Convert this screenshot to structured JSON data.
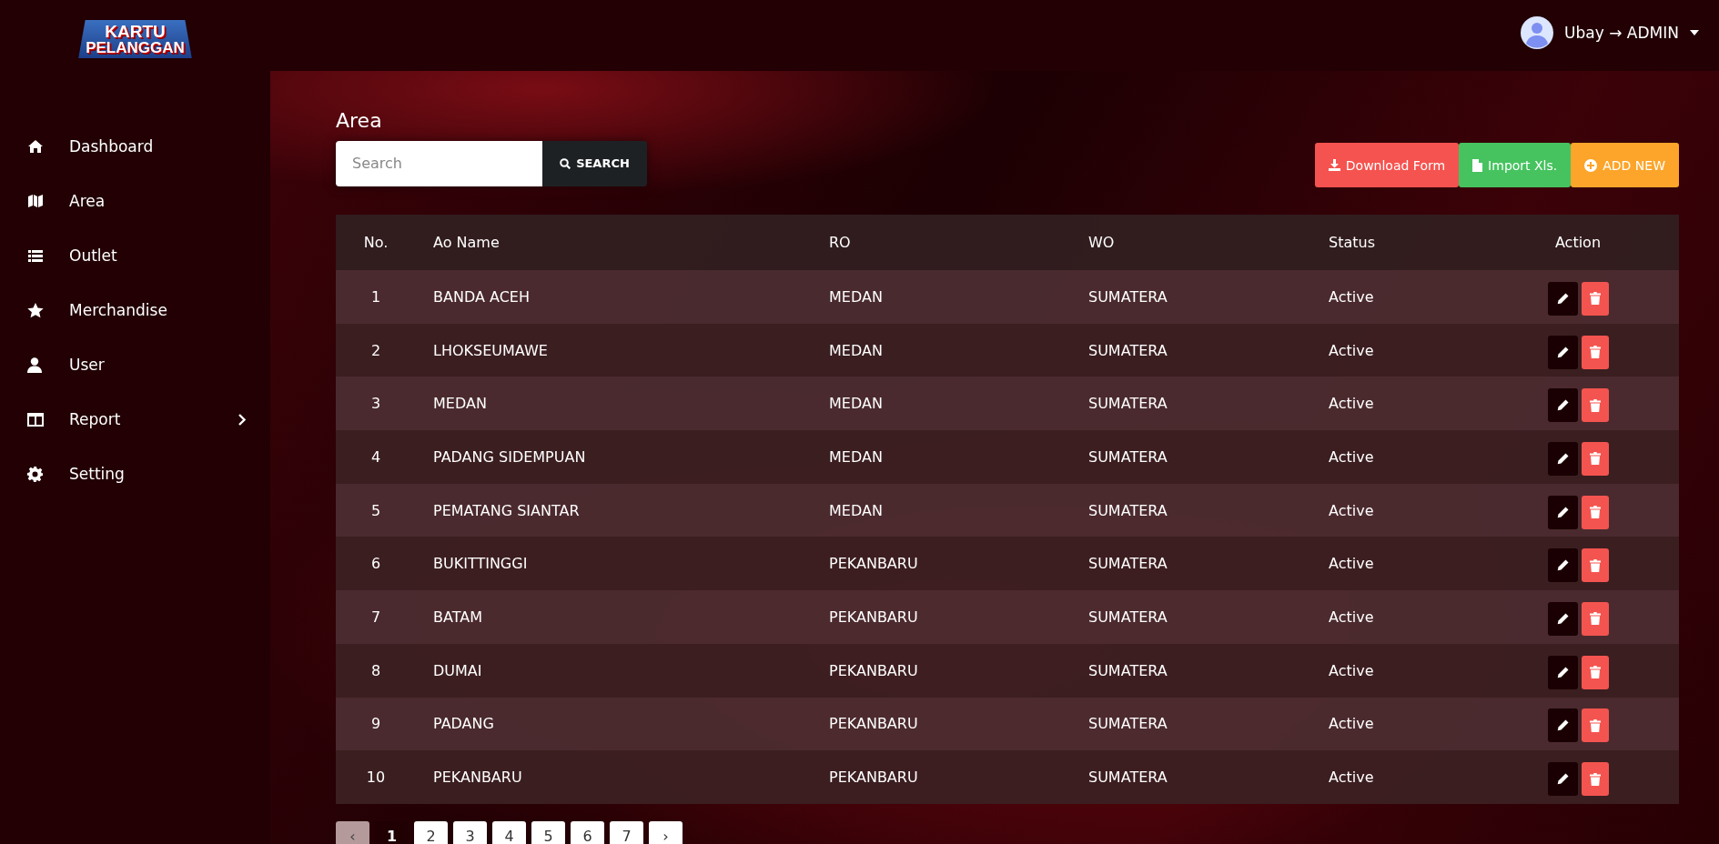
{
  "logo": {
    "line_1": "KARTU",
    "line_2": "PELANGGAN"
  },
  "user": {
    "name": "Ubay → ADMIN"
  },
  "sidebar": {
    "items": [
      {
        "label": "Dashboard",
        "kind": "home",
        "has_submenu": false
      },
      {
        "label": "Area",
        "kind": "map",
        "has_submenu": false
      },
      {
        "label": "Outlet",
        "kind": "list",
        "has_submenu": false
      },
      {
        "label": "Merchandise",
        "kind": "star",
        "has_submenu": false
      },
      {
        "label": "User",
        "kind": "user",
        "has_submenu": false
      },
      {
        "label": "Report",
        "kind": "columns",
        "has_submenu": true
      },
      {
        "label": "Setting",
        "kind": "gear",
        "has_submenu": false
      }
    ]
  },
  "page_title": "Area",
  "search": {
    "placeholder": "Search",
    "button": "SEARCH"
  },
  "actions": [
    {
      "label": "Download Form",
      "kind": "download"
    },
    {
      "label": "Import Xls.",
      "kind": "import"
    },
    {
      "label": "ADD NEW",
      "kind": "add"
    }
  ],
  "table": {
    "columns": [
      "No.",
      "Ao Name",
      "RO",
      "WO",
      "Status",
      "Action"
    ],
    "rows": [
      {
        "no": "1",
        "ao_name": "BANDA ACEH",
        "ro": "MEDAN",
        "wo": "SUMATERA",
        "status": "Active"
      },
      {
        "no": "2",
        "ao_name": "LHOKSEUMAWE",
        "ro": "MEDAN",
        "wo": "SUMATERA",
        "status": "Active"
      },
      {
        "no": "3",
        "ao_name": "MEDAN",
        "ro": "MEDAN",
        "wo": "SUMATERA",
        "status": "Active"
      },
      {
        "no": "4",
        "ao_name": "PADANG SIDEMPUAN",
        "ro": "MEDAN",
        "wo": "SUMATERA",
        "status": "Active"
      },
      {
        "no": "5",
        "ao_name": "PEMATANG SIANTAR",
        "ro": "MEDAN",
        "wo": "SUMATERA",
        "status": "Active"
      },
      {
        "no": "6",
        "ao_name": "BUKITTINGGI",
        "ro": "PEKANBARU",
        "wo": "SUMATERA",
        "status": "Active"
      },
      {
        "no": "7",
        "ao_name": "BATAM",
        "ro": "PEKANBARU",
        "wo": "SUMATERA",
        "status": "Active"
      },
      {
        "no": "8",
        "ao_name": "DUMAI",
        "ro": "PEKANBARU",
        "wo": "SUMATERA",
        "status": "Active"
      },
      {
        "no": "9",
        "ao_name": "PADANG",
        "ro": "PEKANBARU",
        "wo": "SUMATERA",
        "status": "Active"
      },
      {
        "no": "10",
        "ao_name": "PEKANBARU",
        "ro": "PEKANBARU",
        "wo": "SUMATERA",
        "status": "Active"
      }
    ]
  },
  "pagination": {
    "previous": {
      "label": "‹",
      "disabled": true
    },
    "pages": [
      {
        "label": "1",
        "selected": true
      },
      {
        "label": "2",
        "selected": false
      },
      {
        "label": "3",
        "selected": false
      },
      {
        "label": "4",
        "selected": false
      },
      {
        "label": "5",
        "selected": false
      },
      {
        "label": "6",
        "selected": false
      },
      {
        "label": "7",
        "selected": false
      }
    ],
    "next": {
      "label": "›",
      "disabled": false
    }
  }
}
